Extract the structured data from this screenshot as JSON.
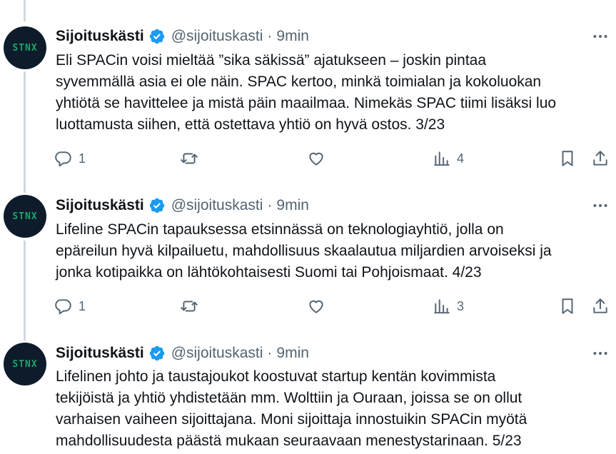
{
  "tweets": [
    {
      "author": "Sijoituskästi",
      "handle": "@sijoituskasti",
      "dot": "·",
      "time": "9min",
      "avatar_text": "STNX",
      "text": "Eli SPACin voisi mieltää ”sika säkissä” ajatukseen – joskin pintaa\nsyvemmällä asia ei ole näin. SPAC kertoo, minkä toimialan ja kokoluokan\nyhtiötä se havittelee ja mistä päin maailmaa. Nimekäs SPAC tiimi lisäksi luo\nluottamusta siihen, että ostettava yhtiö on hyvä ostos. 3/23",
      "replies": "1",
      "retweets": "",
      "likes": "",
      "views": "4"
    },
    {
      "author": "Sijoituskästi",
      "handle": "@sijoituskasti",
      "dot": "·",
      "time": "9min",
      "avatar_text": "STNX",
      "text": "Lifeline SPACin tapauksessa etsinnässä on teknologiayhtiö, jolla on\nepäreilun hyvä kilpailuetu, mahdollisuus skaalautua miljardien arvoiseksi ja\njonka kotipaikka on lähtökohtaisesti Suomi tai Pohjoismaat. 4/23",
      "replies": "1",
      "retweets": "",
      "likes": "",
      "views": "3"
    },
    {
      "author": "Sijoituskästi",
      "handle": "@sijoituskasti",
      "dot": "·",
      "time": "9min",
      "avatar_text": "STNX",
      "text": "Lifelinen johto ja taustajoukot koostuvat startup kentän kovimmista\ntekijöistä ja yhtiö yhdistetään mm. Wolttiin ja Ouraan, joissa se on ollut\nvarhaisen vaiheen sijoittajana. Moni sijoittaja innostuikin SPACin myötä\nmahdollisuudesta päästä mukaan seuraavaan menestystarinaan. 5/23"
    }
  ],
  "colors": {
    "verified": "#1d9bf0",
    "muted": "#536471",
    "thread_line": "#cfd9de",
    "avatar_bg": "#0e1b2b",
    "avatar_text": "#1fa36a"
  },
  "icons": [
    "verified-badge-icon",
    "more-icon",
    "reply-icon",
    "retweet-icon",
    "like-icon",
    "views-icon",
    "bookmark-icon",
    "share-icon"
  ]
}
